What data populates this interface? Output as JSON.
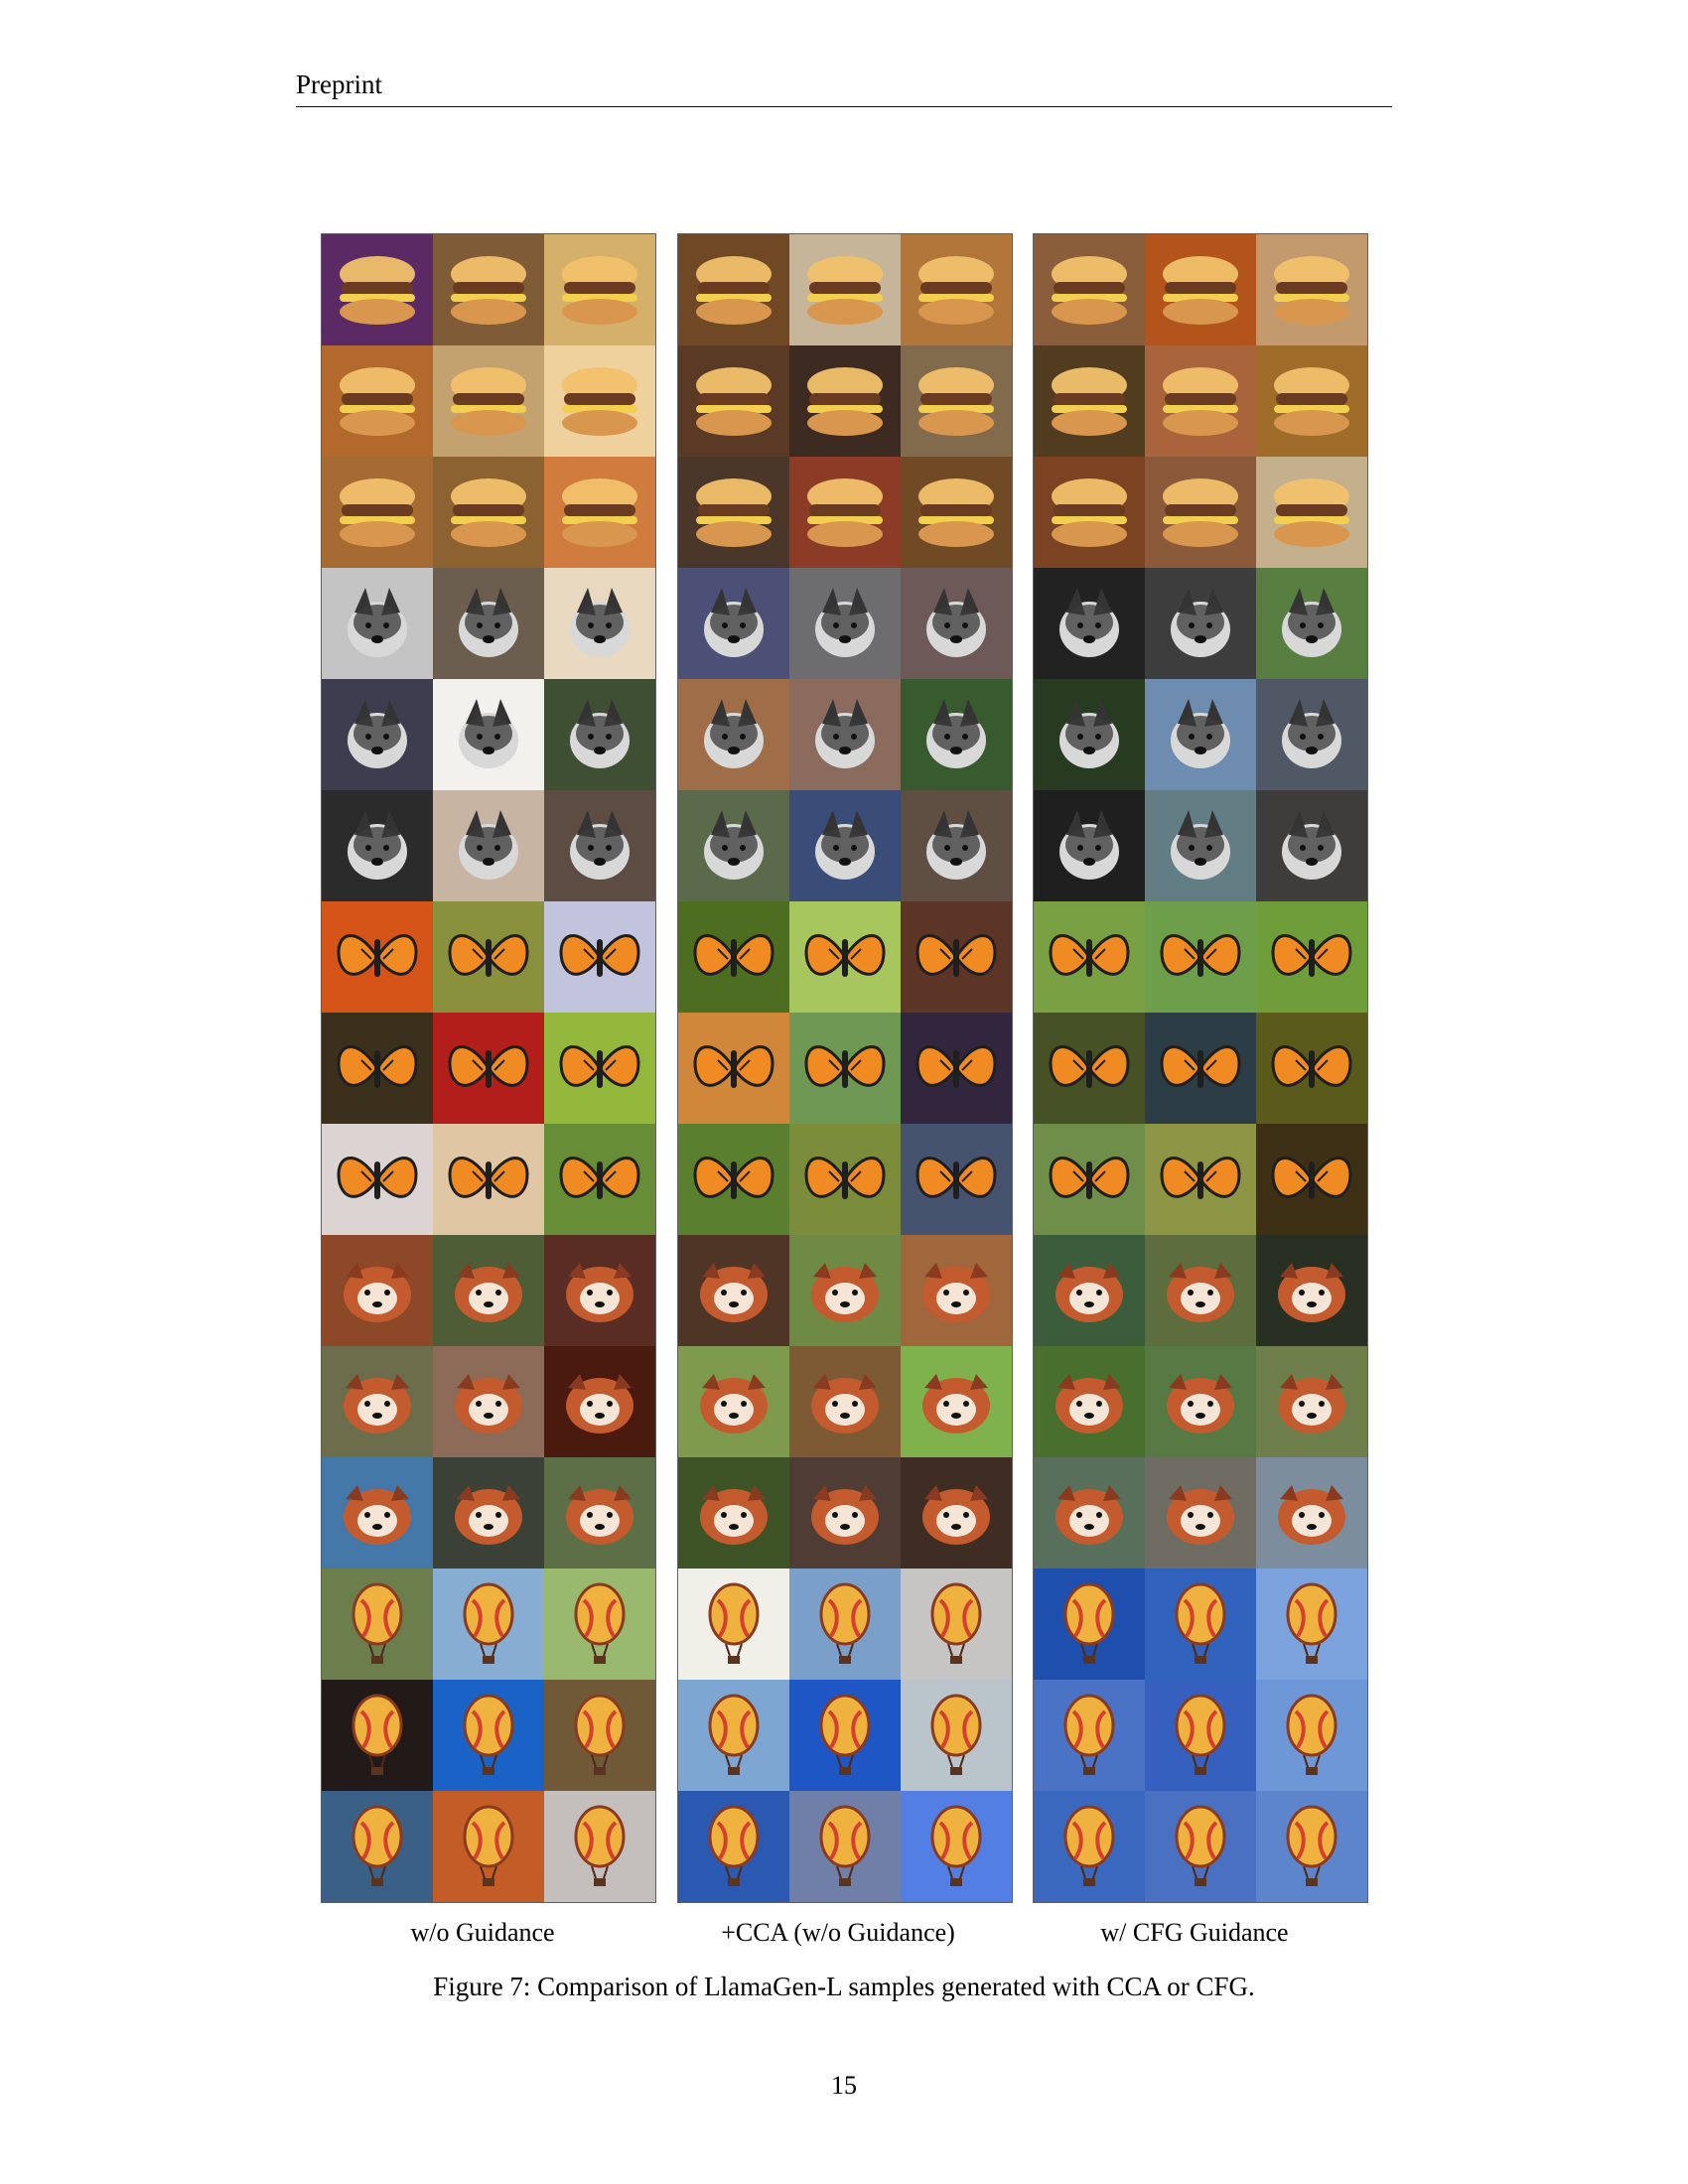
{
  "header": {
    "running_title": "Preprint"
  },
  "figure": {
    "panels": [
      {
        "label": "w/o Guidance",
        "rows": [
          {
            "category": "burger",
            "colors": [
              [
                "#5b2a64",
                "#7f5b37",
                "#d4b06b"
              ],
              [
                "#b4692c",
                "#c4a270",
                "#efd19e"
              ],
              [
                "#a66b33",
                "#8c6231",
                "#d07c3f"
              ]
            ]
          },
          {
            "category": "husky",
            "colors": [
              [
                "#c4c4c4",
                "#6b5e4e",
                "#e8d9c0"
              ],
              [
                "#3e3d4f",
                "#f2f1ee",
                "#3f4f34"
              ],
              [
                "#2b2b2b",
                "#c7b4a3",
                "#5c4c41"
              ]
            ]
          },
          {
            "category": "monarch",
            "colors": [
              [
                "#d65418",
                "#89913c",
                "#c2c4dd"
              ],
              [
                "#3b301c",
                "#b31e1b",
                "#94b83b"
              ],
              [
                "#dcd4d2",
                "#e1c6a3",
                "#678d36"
              ]
            ]
          },
          {
            "category": "red-panda",
            "colors": [
              [
                "#8c4827",
                "#4f5d36",
                "#5a2d24"
              ],
              [
                "#6b6d4b",
                "#8c6b59",
                "#4a1a0f"
              ],
              [
                "#4378a8",
                "#3c4137",
                "#5c6f46"
              ]
            ]
          },
          {
            "category": "balloon",
            "colors": [
              [
                "#6c7e4c",
                "#87add3",
                "#98b96e"
              ],
              [
                "#221a18",
                "#1a62c5",
                "#6f5937"
              ],
              [
                "#3a6087",
                "#c35c26",
                "#c4bfbc"
              ]
            ]
          }
        ]
      },
      {
        "label": "+CCA (w/o Guidance)",
        "rows": [
          {
            "category": "burger",
            "colors": [
              [
                "#6f4926",
                "#c7b599",
                "#b2753a"
              ],
              [
                "#5b3a25",
                "#3d2a21",
                "#826a4c"
              ],
              [
                "#4b362a",
                "#8b3b26",
                "#704a24"
              ]
            ]
          },
          {
            "category": "husky",
            "colors": [
              [
                "#4c5076",
                "#6d6c6e",
                "#6d5a58"
              ],
              [
                "#9f6e49",
                "#8c6b5f",
                "#375a2f"
              ],
              [
                "#5b6a4a",
                "#3a4d79",
                "#5f4f43"
              ]
            ]
          },
          {
            "category": "monarch",
            "colors": [
              [
                "#4d6d21",
                "#a7c65e",
                "#5c3526"
              ],
              [
                "#d0873a",
                "#6e9854",
                "#32263e"
              ],
              [
                "#597f2f",
                "#7b8d3b",
                "#46536f"
              ]
            ]
          },
          {
            "category": "red-panda",
            "colors": [
              [
                "#4f3526",
                "#6e8a44",
                "#a0673d"
              ],
              [
                "#7e9a4c",
                "#7d5a34",
                "#7fb24d"
              ],
              [
                "#3e5326",
                "#4e3c35",
                "#3f2d24"
              ]
            ]
          },
          {
            "category": "balloon",
            "colors": [
              [
                "#f0efe8",
                "#7aa0c9",
                "#c7c5c4"
              ],
              [
                "#7da6d2",
                "#1f56c6",
                "#b9c4cb"
              ],
              [
                "#2b59b2",
                "#6f7fa7",
                "#537ee3"
              ]
            ]
          }
        ]
      },
      {
        "label": "w/ CFG Guidance",
        "rows": [
          {
            "category": "burger",
            "colors": [
              [
                "#8a5d3b",
                "#b3541d",
                "#c39a6e"
              ],
              [
                "#523c1f",
                "#a9643c",
                "#9f6c2a"
              ],
              [
                "#7b4322",
                "#8b5a3b",
                "#c4b08c"
              ]
            ]
          },
          {
            "category": "husky",
            "colors": [
              [
                "#222222",
                "#3d3d3e",
                "#597e41"
              ],
              [
                "#263b1f",
                "#6d8cb0",
                "#4f5864"
              ],
              [
                "#1f1f1f",
                "#637d84",
                "#3e3d3b"
              ]
            ]
          },
          {
            "category": "monarch",
            "colors": [
              [
                "#79a042",
                "#6d9e4a",
                "#6f9d3a"
              ],
              [
                "#465126",
                "#2d3d46",
                "#5a5a1b"
              ],
              [
                "#6f8e49",
                "#8d9645",
                "#3e3014"
              ]
            ]
          },
          {
            "category": "red-panda",
            "colors": [
              [
                "#3c5d3b",
                "#5d6d3d",
                "#273023"
              ],
              [
                "#496f2e",
                "#577943",
                "#6e7f4b"
              ],
              [
                "#58705b",
                "#6f6d63",
                "#7c8e9d"
              ]
            ]
          },
          {
            "category": "balloon",
            "colors": [
              [
                "#1f4fae",
                "#3163be",
                "#7da3de"
              ],
              [
                "#4a72c5",
                "#3660bf",
                "#6d97d7"
              ],
              [
                "#3a68be",
                "#4a70c2",
                "#5d85cc"
              ]
            ]
          }
        ]
      }
    ]
  },
  "caption": "Figure 7: Comparison of LlamaGen-L samples generated with CCA or CFG.",
  "page_number": "15"
}
